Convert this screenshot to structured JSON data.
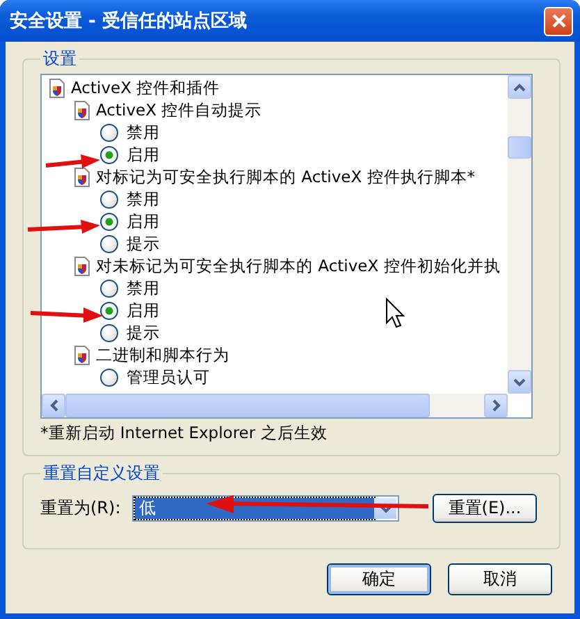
{
  "window": {
    "title": "安全设置 - 受信任的站点区域"
  },
  "settings": {
    "legend": "设置",
    "tree": [
      {
        "label": "ActiveX 控件和插件",
        "children": [
          {
            "label": "ActiveX 控件自动提示",
            "options": [
              {
                "label": "禁用",
                "selected": false
              },
              {
                "label": "启用",
                "selected": true
              }
            ]
          },
          {
            "label": "对标记为可安全执行脚本的 ActiveX 控件执行脚本*",
            "options": [
              {
                "label": "禁用",
                "selected": false
              },
              {
                "label": "启用",
                "selected": true
              },
              {
                "label": "提示",
                "selected": false
              }
            ]
          },
          {
            "label": "对未标记为可安全执行脚本的 ActiveX 控件初始化并执",
            "options": [
              {
                "label": "禁用",
                "selected": false
              },
              {
                "label": "启用",
                "selected": true
              },
              {
                "label": "提示",
                "selected": false
              }
            ]
          },
          {
            "label": "二进制和脚本行为",
            "options": [
              {
                "label": "管理员认可",
                "selected": false
              }
            ]
          }
        ]
      }
    ],
    "note": "*重新启动 Internet Explorer 之后生效"
  },
  "reset": {
    "legend": "重置自定义设置",
    "label": "重置为(R):",
    "value": "低",
    "button": "重置(E)..."
  },
  "buttons": [
    {
      "label": "确定",
      "default": true
    },
    {
      "label": "取消",
      "default": false
    }
  ]
}
